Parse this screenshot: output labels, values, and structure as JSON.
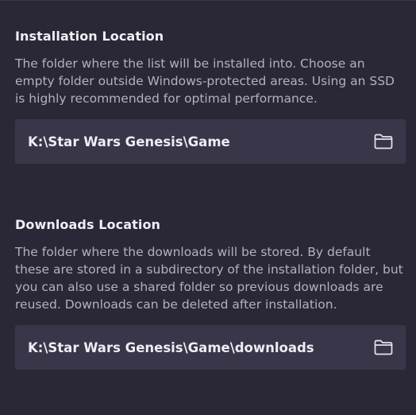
{
  "installation": {
    "heading": "Installation Location",
    "description": "The folder where the list will be installed into. Choose an empty folder outside Windows-protected areas. Using an SSD is highly recommended for optimal performance.",
    "path": "K:\\Star Wars Genesis\\Game",
    "browse_icon": "folder-icon"
  },
  "downloads": {
    "heading": "Downloads Location",
    "description": "The folder where the downloads will be stored. By default these are stored in a subdirectory of the installation folder, but you can also use a shared folder so previous downloads are reused. Downloads can be deleted after installation.",
    "path": "K:\\Star Wars Genesis\\Game\\downloads",
    "browse_icon": "folder-icon"
  },
  "colors": {
    "background": "#2a2836",
    "field_background": "#383648",
    "heading_text": "#f0eef6",
    "description_text": "#b3b0c2"
  }
}
